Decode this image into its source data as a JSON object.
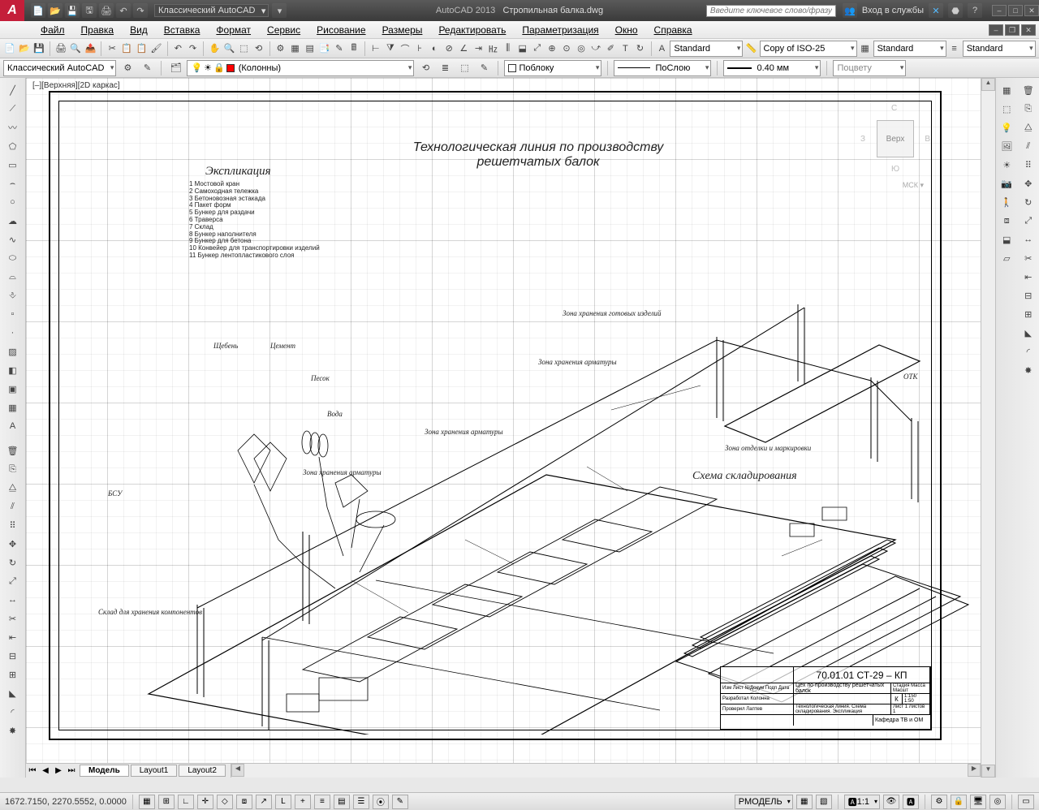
{
  "titlebar": {
    "workspace": "Классический AutoCAD",
    "app": "AutoCAD 2013",
    "filename": "Стропильная балка.dwg",
    "search_placeholder": "Введите ключевое слово/фразу",
    "signin": "Вход в службы",
    "help_tip": "?"
  },
  "menu": {
    "file": "Файл",
    "edit": "Правка",
    "view": "Вид",
    "insert": "Вставка",
    "format": "Формат",
    "service": "Сервис",
    "draw": "Рисование",
    "dimensions": "Размеры",
    "modify": "Редактировать",
    "parametric": "Параметризация",
    "window": "Окно",
    "help": "Справка"
  },
  "toolbar_styles": {
    "textstyle": "Standard",
    "dimstyle": "Copy of ISO-25",
    "tablestyle": "Standard",
    "mlstyle": "Standard"
  },
  "properties": {
    "workspace_dd": "Классический AutoCAD",
    "layer": "(Колонны)",
    "color": "Поблоку",
    "linetype": "ПоСлою",
    "lineweight": "0.40 мм",
    "plotstyle": "Поцвету"
  },
  "viewport": {
    "label": "[–][Верхняя][2D каркас]"
  },
  "viewcube": {
    "face": "Верх",
    "n": "С",
    "s": "Ю",
    "e": "В",
    "w": "З",
    "wcs": "МСК"
  },
  "drawing": {
    "main_title_1": "Технологическая линия по производству",
    "main_title_2": "решетчатых балок",
    "explication_title": "Экспликация",
    "explication_items": [
      "1 Мостовой кран",
      "2 Самоходная тележка",
      "3 Бетоновозная эстакада",
      "4 Пакет форм",
      "5 Бункер для раздачи",
      "6 Траверса",
      "7 Склад",
      "8 Бункер наполнителя",
      "9 Бункер для бетона",
      "10 Конвейер для транспортировки изделий",
      "11 Бункер лентопластикового слоя"
    ],
    "labels": {
      "sheben": "Щебень",
      "cement": "Цемент",
      "pesok": "Песок",
      "voda": "Вода",
      "bsu": "БСУ",
      "otk": "ОТК",
      "sklad": "Склад для хранения компонентов",
      "zona1": "Зона хранения готовых изделий",
      "zona2": "Зона хранения арматуры",
      "zona3": "Зона хранения арматуры",
      "zona4": "Зона хранения арматуры",
      "zona5": "Зона отделки и маркировки",
      "storage_scheme": "Схема складирования"
    }
  },
  "titleblock": {
    "code": "70.01.01  СТ-29  –  КП",
    "row2_desc": "Цех по производству решетчатых балок",
    "row3_desc": "Технологическая линия. Схема складирования. Экспликация",
    "headers": "Изм Лист №Докум Подп Дата",
    "row_a": "Разработал Колонна",
    "row_b": "Проверил Лаптев",
    "stage": "К",
    "col_h": "Стадия Масса Масшт",
    "scale": "1:150\n1:50",
    "sheet": "Лист 1  Листов 1",
    "dept": "Кафедра ТВ и ОМ"
  },
  "tabs": {
    "model": "Модель",
    "layout1": "Layout1",
    "layout2": "Layout2"
  },
  "status": {
    "coords": "1672.7150, 2270.5552, 0.0000",
    "model_btn": "РМОДЕЛЬ",
    "scale": "1:1"
  }
}
